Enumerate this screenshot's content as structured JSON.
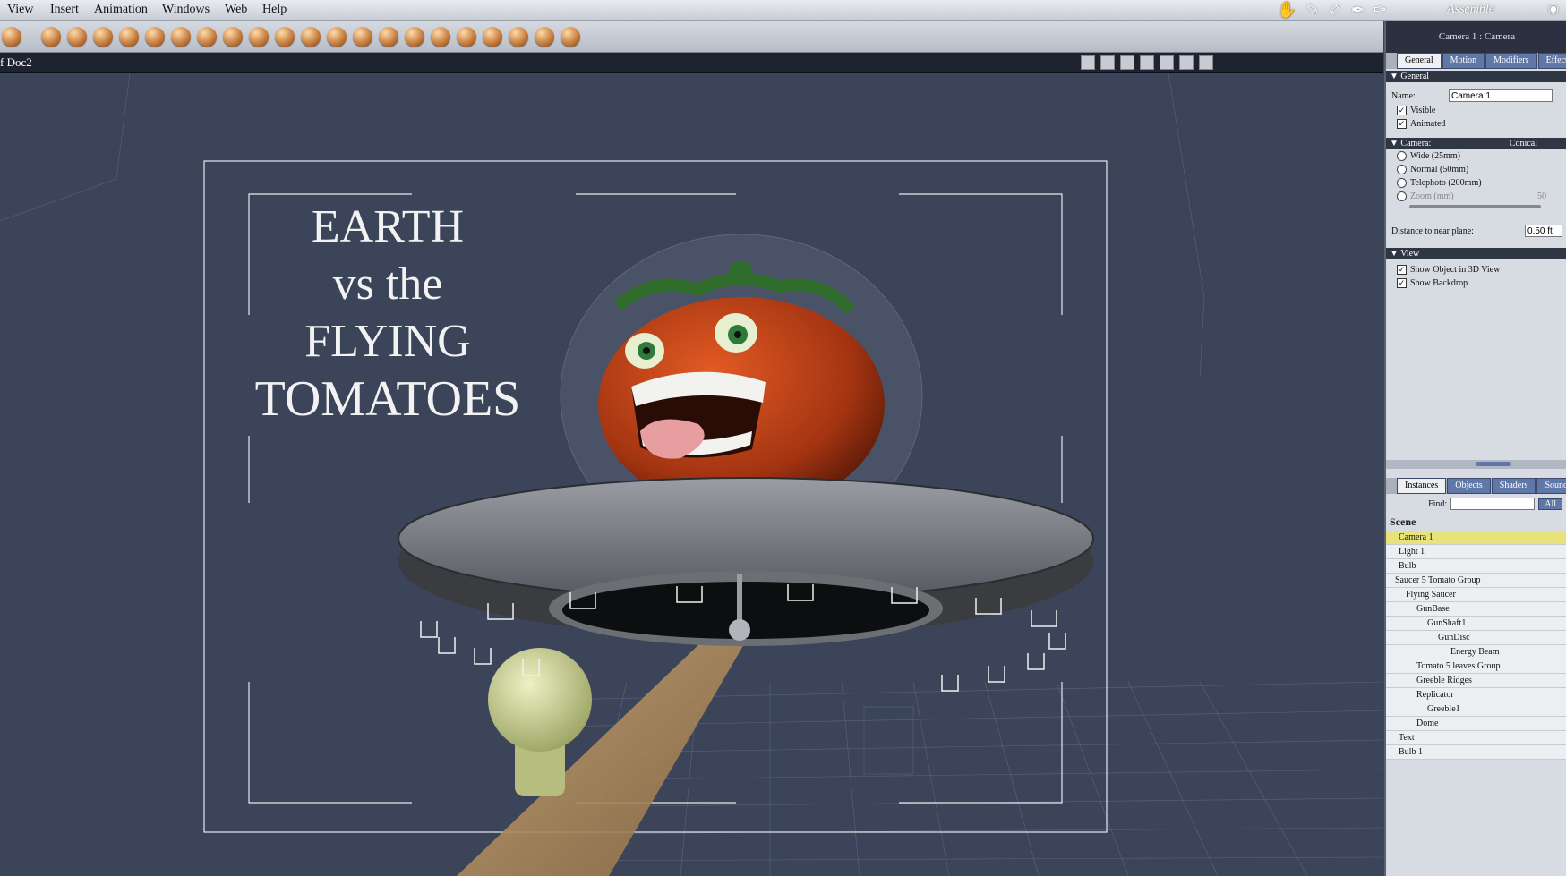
{
  "menu": [
    "View",
    "Insert",
    "Animation",
    "Windows",
    "Web",
    "Help"
  ],
  "room": "Assemble",
  "eye_icon": "eye-icon",
  "document": {
    "title": "f Doc2"
  },
  "viewport": {
    "title_lines": [
      "EARTH",
      "vs the",
      "FLYING",
      "TOMATOES"
    ],
    "colors": {
      "background": "#3b4459",
      "tomato": "#c2461c",
      "saucer": "#6e7177",
      "beam": "#b08a55",
      "bulb": "#c8cf8a"
    }
  },
  "panel": {
    "header": "Camera 1 : Camera",
    "tabs": [
      "General",
      "Motion",
      "Modifiers",
      "Effects"
    ],
    "general": {
      "section": "General",
      "name_label": "Name:",
      "name_value": "Camera 1",
      "visible": "Visible",
      "animated": "Animated"
    },
    "camera": {
      "section": "Camera:",
      "type": "Conical",
      "options": [
        "Wide (25mm)",
        "Normal (50mm)",
        "Telephoto (200mm)"
      ],
      "zoom_label": "Zoom (mm)",
      "zoom_value": "50",
      "near_label": "Distance to near plane:",
      "near_value": "0.50 ft"
    },
    "view": {
      "section": "View",
      "show_object": "Show Object in 3D View",
      "show_backdrop": "Show Backdrop"
    },
    "bottom_tabs": [
      "Instances",
      "Objects",
      "Shaders",
      "Sounds"
    ],
    "find_label": "Find:",
    "find_scope": "All",
    "scene_label": "Scene",
    "scene_items": [
      "Camera 1",
      "Light 1",
      "Bulb",
      "Saucer 5 Tomato Group",
      "Flying Saucer",
      "GunBase",
      "GunShaft1",
      "GunDisc",
      "Energy Beam",
      "Tomato 5 leaves Group",
      "Greeble Ridges",
      "Replicator",
      "Greeble1",
      "Dome",
      "Text",
      "Bulb 1"
    ]
  }
}
